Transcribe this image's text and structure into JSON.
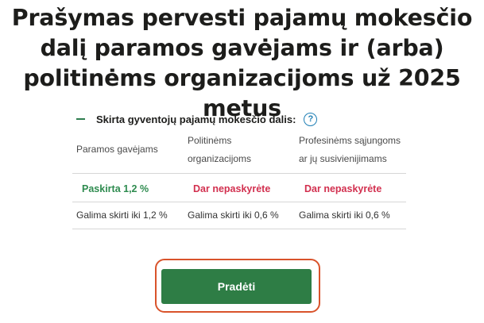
{
  "page_title": "Prašymas pervesti pajamų mokesčio dalį paramos gavėjams ir (arba) politinėms organizacijoms už 2025 metus",
  "section": {
    "label": "Skirta gyventojų pajamų mokesčio dalis:",
    "help_glyph": "?"
  },
  "table": {
    "columns": [
      {
        "header": "Paramos gavėjams",
        "status": "Paskirta 1,2 %",
        "status_color": "#2e8b4f",
        "limit": "Galima skirti iki 1,2 %"
      },
      {
        "header": "Politinėms organizacijoms",
        "status": "Dar nepaskyrėte",
        "status_color": "#d2304f",
        "limit": "Galima skirti iki 0,6 %"
      },
      {
        "header": "Profesinėms sąjungoms ar jų susivienijimams",
        "status": "Dar nepaskyrėte",
        "status_color": "#d2304f",
        "limit": "Galima skirti iki 0,6 %"
      }
    ]
  },
  "start_button": {
    "label": "Pradėti"
  },
  "colors": {
    "primary_green": "#2e7d45",
    "focus_ring": "#d9532b",
    "help_blue": "#1f7fb5"
  }
}
